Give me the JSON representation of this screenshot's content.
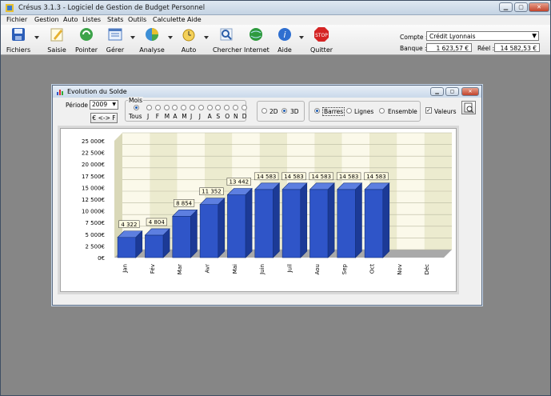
{
  "app": {
    "title": "Crésus 3.1.3 - Logiciel de Gestion de Budget Personnel"
  },
  "menu": [
    "Fichier",
    "Gestion",
    "Auto",
    "Listes",
    "Stats",
    "Outils",
    "Calculette",
    "Aide"
  ],
  "toolbar": {
    "fichiers": "Fichiers",
    "saisie": "Saisie",
    "pointer": "Pointer",
    "gerer": "Gérer",
    "analyse": "Analyse",
    "auto": "Auto",
    "chercher": "Chercher",
    "internet": "Internet",
    "aide": "Aide",
    "quitter": "Quitter"
  },
  "account": {
    "compte_label": "Compte :",
    "compte_value": "Crédit Lyonnais",
    "banque_label": "Banque :",
    "banque_value": "1 623,57 €",
    "reel_label": "Réel :",
    "reel_value": "14 582,53 €"
  },
  "child": {
    "title": "Evolution du Solde",
    "periode_label": "Période :",
    "periode_value": "2009",
    "currency_button": "€ <-> F",
    "mois_label": "Mois",
    "tous_label": "Tous",
    "months_short": [
      "J",
      "F",
      "M",
      "A",
      "M",
      "J",
      "J",
      "A",
      "S",
      "O",
      "N",
      "D"
    ],
    "opt_2d": "2D",
    "opt_3d": "3D",
    "opt_barres": "Barres",
    "opt_lignes": "Lignes",
    "opt_ensemble": "Ensemble",
    "opt_valeurs": "Valeurs"
  },
  "chart_data": {
    "type": "bar",
    "categories": [
      "Jan",
      "Fév",
      "Mar",
      "Avr",
      "Mai",
      "Juin",
      "Juil",
      "Aou",
      "Sep",
      "Oct",
      "Nov",
      "Déc"
    ],
    "values": [
      4322,
      4804,
      8854,
      11352,
      13442,
      14583,
      14583,
      14583,
      14583,
      14583,
      0,
      0
    ],
    "data_labels": [
      "4 322",
      "4 804",
      "8 854",
      "11 352",
      "13 442",
      "14 583",
      "14 583",
      "14 583",
      "14 583",
      "14 583",
      "",
      ""
    ],
    "yticks": [
      "0€",
      "2 500€",
      "5 000€",
      "7 500€",
      "10 000€",
      "12 500€",
      "15 000€",
      "17 500€",
      "20 000€",
      "22 500€",
      "25 000€"
    ],
    "ylim": [
      0,
      25000
    ],
    "bar_color": "#2f55c8",
    "grid": true
  }
}
